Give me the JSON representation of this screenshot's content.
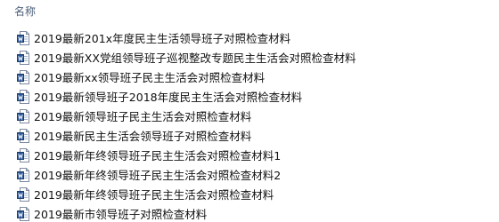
{
  "header": {
    "name_label": "名称"
  },
  "files": [
    {
      "name": "2019最新201x年度民主生活领导班子对照检查材料",
      "icon": "word-document-icon"
    },
    {
      "name": "2019最新XX党组领导班子巡视整改专题民主生活会对照检查材料",
      "icon": "word-document-icon"
    },
    {
      "name": "2019最新xx领导班子民主生活会对照检查材料",
      "icon": "word-document-icon"
    },
    {
      "name": "2019最新领导班子2018年度民主生活会对照检查材料",
      "icon": "word-document-icon"
    },
    {
      "name": "2019最新领导班子民主生活会对照检查材料",
      "icon": "word-document-icon"
    },
    {
      "name": "2019最新民主生活会领导班子对照检查材料",
      "icon": "word-document-icon"
    },
    {
      "name": "2019最新年终领导班子民主生活会对照检查材料1",
      "icon": "word-document-icon"
    },
    {
      "name": "2019最新年终领导班子民主生活会对照检查材料2",
      "icon": "word-document-icon"
    },
    {
      "name": "2019最新年终领导班子民主生活会对照检查材料",
      "icon": "word-document-icon"
    },
    {
      "name": "2019最新市领导班子对照检查材料",
      "icon": "word-document-icon"
    }
  ]
}
